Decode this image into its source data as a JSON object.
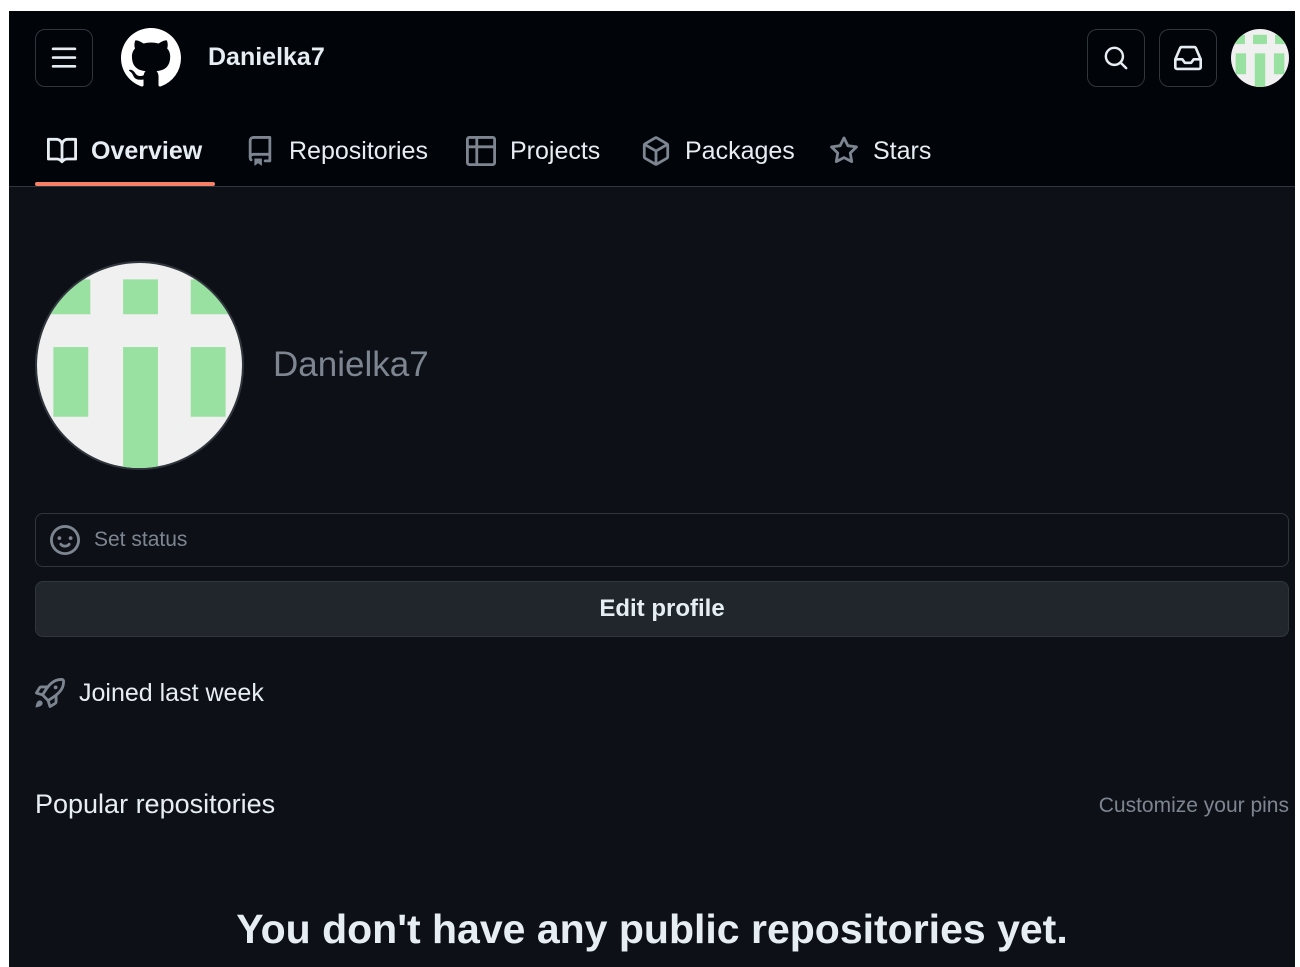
{
  "header": {
    "username": "Danielka7",
    "menu_icon": "hamburger-menu-icon",
    "logo_icon": "github-logo-icon",
    "search_icon": "search-icon",
    "inbox_icon": "inbox-icon"
  },
  "tabs": [
    {
      "label": "Overview",
      "icon": "book-icon",
      "active": true
    },
    {
      "label": "Repositories",
      "icon": "repo-icon",
      "active": false
    },
    {
      "label": "Projects",
      "icon": "table-icon",
      "active": false
    },
    {
      "label": "Packages",
      "icon": "package-icon",
      "active": false
    },
    {
      "label": "Stars",
      "icon": "star-icon",
      "active": false
    }
  ],
  "profile": {
    "name": "Danielka7",
    "set_status_label": "Set status",
    "edit_profile_label": "Edit profile",
    "joined_label": "Joined last week"
  },
  "popular": {
    "title": "Popular repositories",
    "customize_label": "Customize your pins",
    "empty_message": "You don't have any public repositories yet."
  },
  "colors": {
    "background": "#0d1117",
    "header_background": "#010409",
    "border": "#30363d",
    "text_primary": "#e6edf3",
    "text_muted": "#7d8590",
    "active_tab_underline": "#f78166",
    "avatar_green": "#98e1a0",
    "avatar_bg": "#f0f0f0"
  }
}
